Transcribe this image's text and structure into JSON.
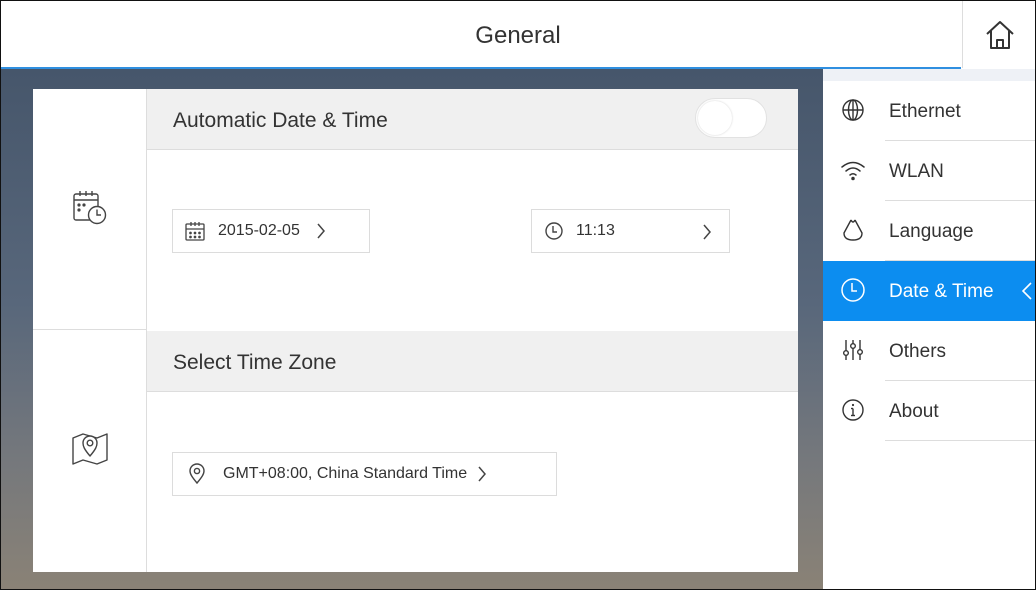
{
  "header": {
    "title": "General",
    "home_icon": "home-icon"
  },
  "sections": {
    "auto_time": {
      "label": "Automatic Date & Time",
      "toggle_on": false,
      "icon": "calendar-clock-icon",
      "date_value": "2015-02-05",
      "date_icon": "calendar-icon",
      "time_value": "11:13",
      "time_icon": "clock-icon"
    },
    "time_zone": {
      "label": "Select Time Zone",
      "icon": "map-pin-icon",
      "value": "GMT+08:00, China Standard Time",
      "value_icon": "location-pin-icon"
    }
  },
  "sidebar": {
    "items": [
      {
        "label": "Ethernet",
        "icon": "globe-icon",
        "active": false
      },
      {
        "label": "WLAN",
        "icon": "wifi-icon",
        "active": false
      },
      {
        "label": "Language",
        "icon": "language-icon",
        "active": false
      },
      {
        "label": "Date & Time",
        "icon": "clock-icon",
        "active": true
      },
      {
        "label": "Others",
        "icon": "sliders-icon",
        "active": false
      },
      {
        "label": "About",
        "icon": "info-icon",
        "active": false
      }
    ]
  },
  "colors": {
    "accent": "#0c8df0",
    "header_line": "#2f8fe0"
  }
}
